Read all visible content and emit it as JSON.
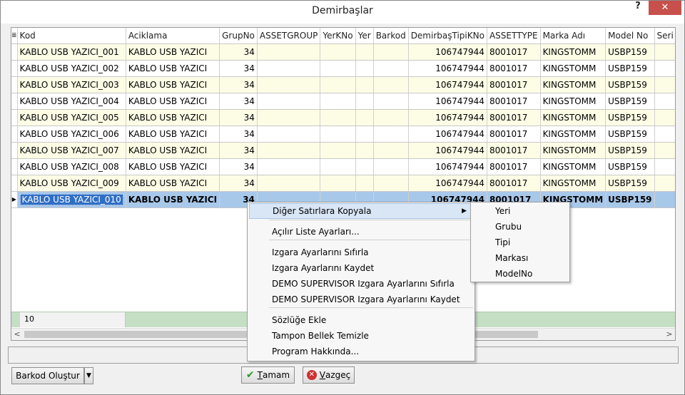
{
  "window": {
    "title": "Demirbaşlar",
    "help_label": "?",
    "close_label": "✕"
  },
  "grid": {
    "columns": [
      "Kod",
      "Aciklama",
      "GrupNo",
      "ASSETGROUP",
      "YerKNo",
      "Yer",
      "Barkod",
      "DemirbaşTipiKNo",
      "ASSETTYPE",
      "Marka Adı",
      "Model No",
      "Seri No"
    ],
    "rows": [
      [
        "KABLO USB YAZICI_001",
        "KABLO USB YAZICI",
        "34",
        "",
        "",
        "",
        "",
        "106747944",
        "8001017",
        "KINGSTOMM",
        "USBP159",
        ""
      ],
      [
        "KABLO USB YAZICI_002",
        "KABLO USB YAZICI",
        "34",
        "",
        "",
        "",
        "",
        "106747944",
        "8001017",
        "KINGSTOMM",
        "USBP159",
        ""
      ],
      [
        "KABLO USB YAZICI_003",
        "KABLO USB YAZICI",
        "34",
        "",
        "",
        "",
        "",
        "106747944",
        "8001017",
        "KINGSTOMM",
        "USBP159",
        ""
      ],
      [
        "KABLO USB YAZICI_004",
        "KABLO USB YAZICI",
        "34",
        "",
        "",
        "",
        "",
        "106747944",
        "8001017",
        "KINGSTOMM",
        "USBP159",
        ""
      ],
      [
        "KABLO USB YAZICI_005",
        "KABLO USB YAZICI",
        "34",
        "",
        "",
        "",
        "",
        "106747944",
        "8001017",
        "KINGSTOMM",
        "USBP159",
        ""
      ],
      [
        "KABLO USB YAZICI_006",
        "KABLO USB YAZICI",
        "34",
        "",
        "",
        "",
        "",
        "106747944",
        "8001017",
        "KINGSTOMM",
        "USBP159",
        ""
      ],
      [
        "KABLO USB YAZICI_007",
        "KABLO USB YAZICI",
        "34",
        "",
        "",
        "",
        "",
        "106747944",
        "8001017",
        "KINGSTOMM",
        "USBP159",
        ""
      ],
      [
        "KABLO USB YAZICI_008",
        "KABLO USB YAZICI",
        "34",
        "",
        "",
        "",
        "",
        "106747944",
        "8001017",
        "KINGSTOMM",
        "USBP159",
        ""
      ],
      [
        "KABLO USB YAZICI_009",
        "KABLO USB YAZICI",
        "34",
        "",
        "",
        "",
        "",
        "106747944",
        "8001017",
        "KINGSTOMM",
        "USBP159",
        ""
      ],
      [
        "KABLO USB YAZICI_010",
        "KABLO USB YAZICI",
        "34",
        "",
        "",
        "",
        "",
        "106747944",
        "8001017",
        "KINGSTOMM",
        "USBP159",
        ""
      ]
    ],
    "selected_row": 9,
    "footer_count": "10"
  },
  "context_menu": {
    "items": [
      {
        "label": "Diğer Satırlara Kopyala",
        "has_submenu": true
      },
      {
        "label": "Açılır Liste Ayarları..."
      },
      {
        "label": "Izgara Ayarlarını Sıfırla"
      },
      {
        "label": "Izgara Ayarlarını Kaydet"
      },
      {
        "label": "DEMO SUPERVISOR Izgara Ayarlarını Sıfırla"
      },
      {
        "label": "DEMO SUPERVISOR Izgara Ayarlarını Kaydet"
      },
      {
        "label": "Sözlüğe Ekle"
      },
      {
        "label": "Tampon Bellek Temizle"
      },
      {
        "label": "Program Hakkında..."
      }
    ],
    "submenu": [
      "Yeri",
      "Grubu",
      "Tipi",
      "Markası",
      "ModelNo"
    ]
  },
  "buttons": {
    "barkod_label": "Barkod Oluştur",
    "ok_label": "Tamam",
    "ok_mnemonic": "T",
    "cancel_label": "Vazgeç",
    "cancel_mnemonic": "V"
  },
  "colors": {
    "odd_row": "#fdfde6",
    "selected_row": "#a8c8ea",
    "footer": "#c5dfc5",
    "close": "#c7504c"
  }
}
